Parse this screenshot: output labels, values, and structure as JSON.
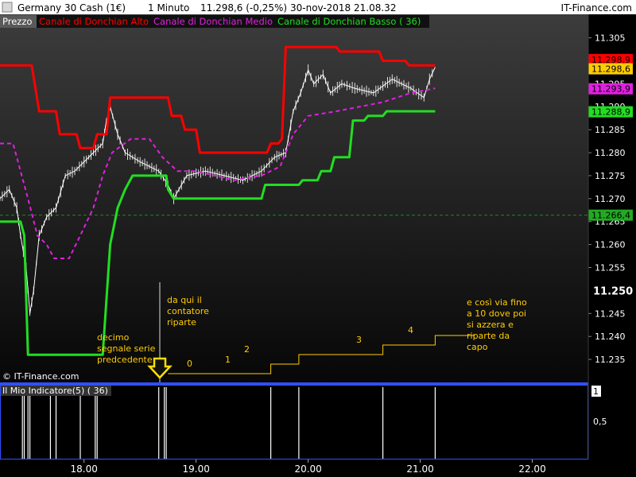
{
  "header": {
    "instrument": "Germany 30 Cash (1€)",
    "timeframe": "1 Minuto",
    "last": "11.298,6 (-0,25%)",
    "datetime": "30-nov-2018 21.08.32",
    "brand": "IT-Finance.com"
  },
  "legend": {
    "price": "Prezzo",
    "upper": "Canale di Donchian Alto",
    "middle": "Canale di Donchian Medio",
    "lower": "Canale di Donchian Basso ( 36)"
  },
  "colors": {
    "upper": "#ff0000",
    "middle": "#e020e0",
    "lower": "#22dd22",
    "price": "#ffffff",
    "annotation": "#ffcc00",
    "panel_border": "#3050ff"
  },
  "watermark": "© IT-Finance.com",
  "indicator_label": "Il Mio Indicatore(5) ( 36)",
  "annotations": {
    "left_note": [
      "decimo",
      "segnale serie",
      "predcedente"
    ],
    "mid_note": [
      "da qui il",
      "contatore",
      "riparte"
    ],
    "right_note": [
      "e così via fino",
      "a 10 dove poi",
      "si azzera e",
      "riparte da",
      "capo"
    ],
    "counters": [
      "0",
      "1",
      "2",
      "3",
      "4"
    ]
  },
  "chart_data": {
    "type": "line",
    "x_axis": {
      "ticks": [
        "18.00",
        "19.00",
        "20.00",
        "21.00",
        "22.00"
      ],
      "xlim": [
        "17:15",
        "22:30"
      ]
    },
    "y_axis": {
      "ylim": [
        11230,
        11307
      ],
      "ticks": [
        "11.305",
        "11.300",
        "11.295",
        "11.290",
        "11.285",
        "11.280",
        "11.275",
        "11.270",
        "11.265",
        "11.260",
        "11.255",
        "11.245",
        "11.240",
        "11.235"
      ],
      "bold_tick": "11.250",
      "price_tags": [
        {
          "label": "11.298,9",
          "value": 11298.9,
          "color": "#ff0000"
        },
        {
          "label": "11.298,6",
          "value": 11298.6,
          "color": "#ffcc00"
        },
        {
          "label": "11.293,9",
          "value": 11293.9,
          "color": "#e020e0"
        },
        {
          "label": "11.288,9",
          "value": 11288.9,
          "color": "#22dd22"
        },
        {
          "label": "11.266,4",
          "value": 11266.4,
          "color": "#22aa22"
        }
      ]
    },
    "reference_level": 11266.4,
    "series": [
      {
        "name": "Canale di Donchian Alto",
        "points": [
          [
            "17:15",
            11299
          ],
          [
            "17:32",
            11299
          ],
          [
            "17:36",
            11289
          ],
          [
            "17:45",
            11289
          ],
          [
            "17:47",
            11284
          ],
          [
            "17:56",
            11284
          ],
          [
            "17:58",
            11281
          ],
          [
            "18:05",
            11281
          ],
          [
            "18:07",
            11284
          ],
          [
            "18:12",
            11284
          ],
          [
            "18:14",
            11292
          ],
          [
            "18:45",
            11292
          ],
          [
            "18:47",
            11288
          ],
          [
            "18:52",
            11288
          ],
          [
            "18:54",
            11285
          ],
          [
            "19:00",
            11285
          ],
          [
            "19:02",
            11280
          ],
          [
            "19:38",
            11280
          ],
          [
            "19:40",
            11282
          ],
          [
            "19:44",
            11282
          ],
          [
            "19:46",
            11283
          ],
          [
            "19:48",
            11303
          ],
          [
            "20:15",
            11303
          ],
          [
            "20:17",
            11302
          ],
          [
            "20:38",
            11302
          ],
          [
            "20:40",
            11300
          ],
          [
            "20:52",
            11300
          ],
          [
            "20:54",
            11299
          ],
          [
            "21:08",
            11299
          ]
        ]
      },
      {
        "name": "Canale di Donchian Medio",
        "points": [
          [
            "17:15",
            11282
          ],
          [
            "17:22",
            11282
          ],
          [
            "17:30",
            11270
          ],
          [
            "17:35",
            11262
          ],
          [
            "17:40",
            11260
          ],
          [
            "17:44",
            11257
          ],
          [
            "17:52",
            11257
          ],
          [
            "17:58",
            11262
          ],
          [
            "18:05",
            11268
          ],
          [
            "18:10",
            11275
          ],
          [
            "18:15",
            11280
          ],
          [
            "18:25",
            11283
          ],
          [
            "18:35",
            11283
          ],
          [
            "18:42",
            11279
          ],
          [
            "18:50",
            11276
          ],
          [
            "19:00",
            11276
          ],
          [
            "19:20",
            11274
          ],
          [
            "19:35",
            11275
          ],
          [
            "19:45",
            11277
          ],
          [
            "19:52",
            11284
          ],
          [
            "20:00",
            11288
          ],
          [
            "20:15",
            11289
          ],
          [
            "20:40",
            11291
          ],
          [
            "20:55",
            11293
          ],
          [
            "21:08",
            11294
          ]
        ]
      },
      {
        "name": "Canale di Donchian Basso ( 36)",
        "points": [
          [
            "17:15",
            11265
          ],
          [
            "17:26",
            11265
          ],
          [
            "17:28",
            11262
          ],
          [
            "17:30",
            11236
          ],
          [
            "18:10",
            11236
          ],
          [
            "18:14",
            11260
          ],
          [
            "18:18",
            11268
          ],
          [
            "18:22",
            11272
          ],
          [
            "18:26",
            11275
          ],
          [
            "18:44",
            11275
          ],
          [
            "18:45",
            11272
          ],
          [
            "18:48",
            11270
          ],
          [
            "19:35",
            11270
          ],
          [
            "19:37",
            11273
          ],
          [
            "19:55",
            11273
          ],
          [
            "19:57",
            11274
          ],
          [
            "20:05",
            11274
          ],
          [
            "20:07",
            11276
          ],
          [
            "20:12",
            11276
          ],
          [
            "20:14",
            11279
          ],
          [
            "20:22",
            11279
          ],
          [
            "20:24",
            11287
          ],
          [
            "20:30",
            11287
          ],
          [
            "20:32",
            11288
          ],
          [
            "20:40",
            11288
          ],
          [
            "20:42",
            11289
          ],
          [
            "21:08",
            11289
          ]
        ]
      },
      {
        "name": "Prezzo",
        "points": [
          [
            "17:15",
            11270
          ],
          [
            "17:20",
            11272
          ],
          [
            "17:24",
            11268
          ],
          [
            "17:26",
            11262
          ],
          [
            "17:29",
            11255
          ],
          [
            "17:31",
            11245
          ],
          [
            "17:33",
            11250
          ],
          [
            "17:36",
            11262
          ],
          [
            "17:40",
            11266
          ],
          [
            "17:45",
            11268
          ],
          [
            "17:50",
            11275
          ],
          [
            "17:55",
            11276
          ],
          [
            "18:00",
            11278
          ],
          [
            "18:05",
            11280
          ],
          [
            "18:10",
            11282
          ],
          [
            "18:12",
            11287
          ],
          [
            "18:14",
            11290
          ],
          [
            "18:18",
            11284
          ],
          [
            "18:22",
            11280
          ],
          [
            "18:30",
            11278
          ],
          [
            "18:40",
            11276
          ],
          [
            "18:45",
            11273
          ],
          [
            "18:48",
            11270
          ],
          [
            "18:55",
            11275
          ],
          [
            "19:05",
            11276
          ],
          [
            "19:15",
            11275
          ],
          [
            "19:25",
            11274
          ],
          [
            "19:35",
            11276
          ],
          [
            "19:42",
            11279
          ],
          [
            "19:48",
            11280
          ],
          [
            "19:52",
            11289
          ],
          [
            "19:56",
            11293
          ],
          [
            "20:00",
            11298
          ],
          [
            "20:03",
            11295
          ],
          [
            "20:08",
            11297
          ],
          [
            "20:12",
            11293
          ],
          [
            "20:18",
            11295
          ],
          [
            "20:25",
            11294
          ],
          [
            "20:35",
            11293
          ],
          [
            "20:45",
            11296
          ],
          [
            "20:55",
            11294
          ],
          [
            "21:02",
            11292
          ],
          [
            "21:05",
            11296
          ],
          [
            "21:08",
            11298.6
          ]
        ]
      }
    ],
    "counter_steps": [
      {
        "label": "0",
        "x": "18:45",
        "value": 0
      },
      {
        "label": "1",
        "x": "19:40",
        "value": 1
      },
      {
        "label": "2",
        "x": "19:55",
        "value": 2
      },
      {
        "label": "3",
        "x": "20:40",
        "value": 3
      },
      {
        "label": "4",
        "x": "21:08",
        "value": 4
      }
    ],
    "indicator": {
      "name": "Il Mio Indicatore(5) ( 36)",
      "ylim": [
        0,
        1
      ],
      "ticks": [
        "1",
        "0,5"
      ],
      "signals": [
        "17:27",
        "17:28",
        "17:30",
        "17:31",
        "17:42",
        "17:45",
        "17:58",
        "18:06",
        "18:07",
        "18:40",
        "18:43",
        "18:44",
        "19:40",
        "19:55",
        "20:40",
        "21:08"
      ]
    }
  }
}
